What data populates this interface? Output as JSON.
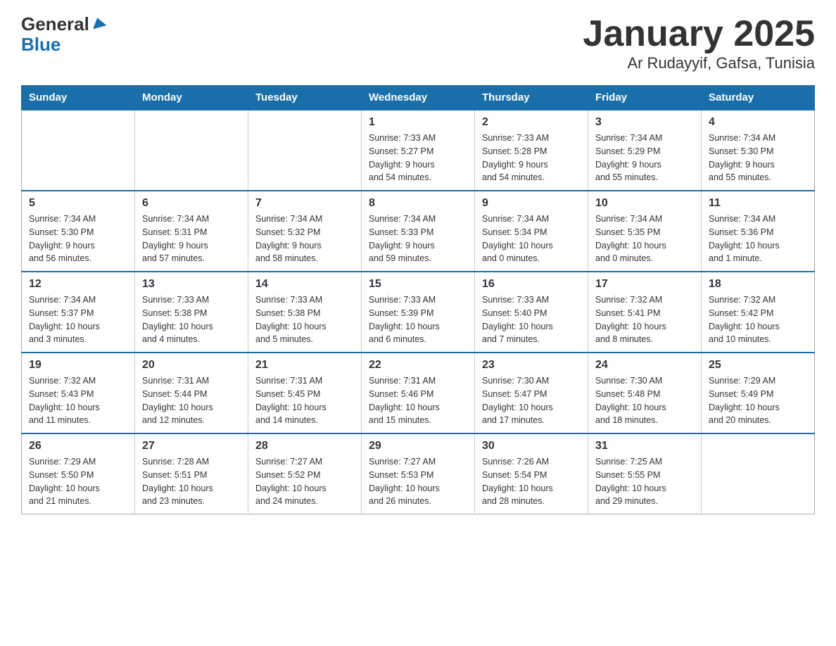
{
  "header": {
    "logo_general": "General",
    "logo_blue": "Blue",
    "title": "January 2025",
    "subtitle": "Ar Rudayyif, Gafsa, Tunisia"
  },
  "days_of_week": [
    "Sunday",
    "Monday",
    "Tuesday",
    "Wednesday",
    "Thursday",
    "Friday",
    "Saturday"
  ],
  "weeks": [
    [
      {
        "day": "",
        "info": ""
      },
      {
        "day": "",
        "info": ""
      },
      {
        "day": "",
        "info": ""
      },
      {
        "day": "1",
        "info": "Sunrise: 7:33 AM\nSunset: 5:27 PM\nDaylight: 9 hours\nand 54 minutes."
      },
      {
        "day": "2",
        "info": "Sunrise: 7:33 AM\nSunset: 5:28 PM\nDaylight: 9 hours\nand 54 minutes."
      },
      {
        "day": "3",
        "info": "Sunrise: 7:34 AM\nSunset: 5:29 PM\nDaylight: 9 hours\nand 55 minutes."
      },
      {
        "day": "4",
        "info": "Sunrise: 7:34 AM\nSunset: 5:30 PM\nDaylight: 9 hours\nand 55 minutes."
      }
    ],
    [
      {
        "day": "5",
        "info": "Sunrise: 7:34 AM\nSunset: 5:30 PM\nDaylight: 9 hours\nand 56 minutes."
      },
      {
        "day": "6",
        "info": "Sunrise: 7:34 AM\nSunset: 5:31 PM\nDaylight: 9 hours\nand 57 minutes."
      },
      {
        "day": "7",
        "info": "Sunrise: 7:34 AM\nSunset: 5:32 PM\nDaylight: 9 hours\nand 58 minutes."
      },
      {
        "day": "8",
        "info": "Sunrise: 7:34 AM\nSunset: 5:33 PM\nDaylight: 9 hours\nand 59 minutes."
      },
      {
        "day": "9",
        "info": "Sunrise: 7:34 AM\nSunset: 5:34 PM\nDaylight: 10 hours\nand 0 minutes."
      },
      {
        "day": "10",
        "info": "Sunrise: 7:34 AM\nSunset: 5:35 PM\nDaylight: 10 hours\nand 0 minutes."
      },
      {
        "day": "11",
        "info": "Sunrise: 7:34 AM\nSunset: 5:36 PM\nDaylight: 10 hours\nand 1 minute."
      }
    ],
    [
      {
        "day": "12",
        "info": "Sunrise: 7:34 AM\nSunset: 5:37 PM\nDaylight: 10 hours\nand 3 minutes."
      },
      {
        "day": "13",
        "info": "Sunrise: 7:33 AM\nSunset: 5:38 PM\nDaylight: 10 hours\nand 4 minutes."
      },
      {
        "day": "14",
        "info": "Sunrise: 7:33 AM\nSunset: 5:38 PM\nDaylight: 10 hours\nand 5 minutes."
      },
      {
        "day": "15",
        "info": "Sunrise: 7:33 AM\nSunset: 5:39 PM\nDaylight: 10 hours\nand 6 minutes."
      },
      {
        "day": "16",
        "info": "Sunrise: 7:33 AM\nSunset: 5:40 PM\nDaylight: 10 hours\nand 7 minutes."
      },
      {
        "day": "17",
        "info": "Sunrise: 7:32 AM\nSunset: 5:41 PM\nDaylight: 10 hours\nand 8 minutes."
      },
      {
        "day": "18",
        "info": "Sunrise: 7:32 AM\nSunset: 5:42 PM\nDaylight: 10 hours\nand 10 minutes."
      }
    ],
    [
      {
        "day": "19",
        "info": "Sunrise: 7:32 AM\nSunset: 5:43 PM\nDaylight: 10 hours\nand 11 minutes."
      },
      {
        "day": "20",
        "info": "Sunrise: 7:31 AM\nSunset: 5:44 PM\nDaylight: 10 hours\nand 12 minutes."
      },
      {
        "day": "21",
        "info": "Sunrise: 7:31 AM\nSunset: 5:45 PM\nDaylight: 10 hours\nand 14 minutes."
      },
      {
        "day": "22",
        "info": "Sunrise: 7:31 AM\nSunset: 5:46 PM\nDaylight: 10 hours\nand 15 minutes."
      },
      {
        "day": "23",
        "info": "Sunrise: 7:30 AM\nSunset: 5:47 PM\nDaylight: 10 hours\nand 17 minutes."
      },
      {
        "day": "24",
        "info": "Sunrise: 7:30 AM\nSunset: 5:48 PM\nDaylight: 10 hours\nand 18 minutes."
      },
      {
        "day": "25",
        "info": "Sunrise: 7:29 AM\nSunset: 5:49 PM\nDaylight: 10 hours\nand 20 minutes."
      }
    ],
    [
      {
        "day": "26",
        "info": "Sunrise: 7:29 AM\nSunset: 5:50 PM\nDaylight: 10 hours\nand 21 minutes."
      },
      {
        "day": "27",
        "info": "Sunrise: 7:28 AM\nSunset: 5:51 PM\nDaylight: 10 hours\nand 23 minutes."
      },
      {
        "day": "28",
        "info": "Sunrise: 7:27 AM\nSunset: 5:52 PM\nDaylight: 10 hours\nand 24 minutes."
      },
      {
        "day": "29",
        "info": "Sunrise: 7:27 AM\nSunset: 5:53 PM\nDaylight: 10 hours\nand 26 minutes."
      },
      {
        "day": "30",
        "info": "Sunrise: 7:26 AM\nSunset: 5:54 PM\nDaylight: 10 hours\nand 28 minutes."
      },
      {
        "day": "31",
        "info": "Sunrise: 7:25 AM\nSunset: 5:55 PM\nDaylight: 10 hours\nand 29 minutes."
      },
      {
        "day": "",
        "info": ""
      }
    ]
  ]
}
